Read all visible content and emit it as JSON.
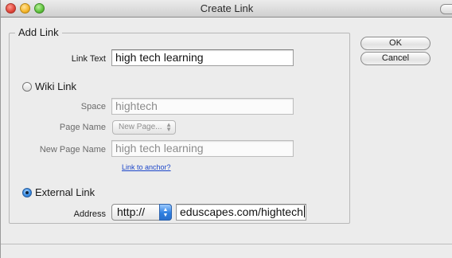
{
  "window": {
    "title": "Create Link"
  },
  "add_link": {
    "group_title": "Add Link",
    "link_text_label": "Link Text",
    "link_text_value": "high tech learning"
  },
  "wiki_link": {
    "radio_label": "Wiki Link",
    "selected": false,
    "space_label": "Space",
    "space_value": "hightech",
    "page_name_label": "Page Name",
    "page_name_value": "New Page...",
    "new_page_name_label": "New Page Name",
    "new_page_name_value": "high tech learning",
    "anchor_link": "Link to anchor?"
  },
  "external_link": {
    "radio_label": "External Link",
    "selected": true,
    "address_label": "Address",
    "protocol_value": "http://",
    "address_value": "eduscapes.com/hightech"
  },
  "buttons": {
    "ok": "OK",
    "cancel": "Cancel"
  },
  "icons": {
    "stepper": "↑↓"
  }
}
